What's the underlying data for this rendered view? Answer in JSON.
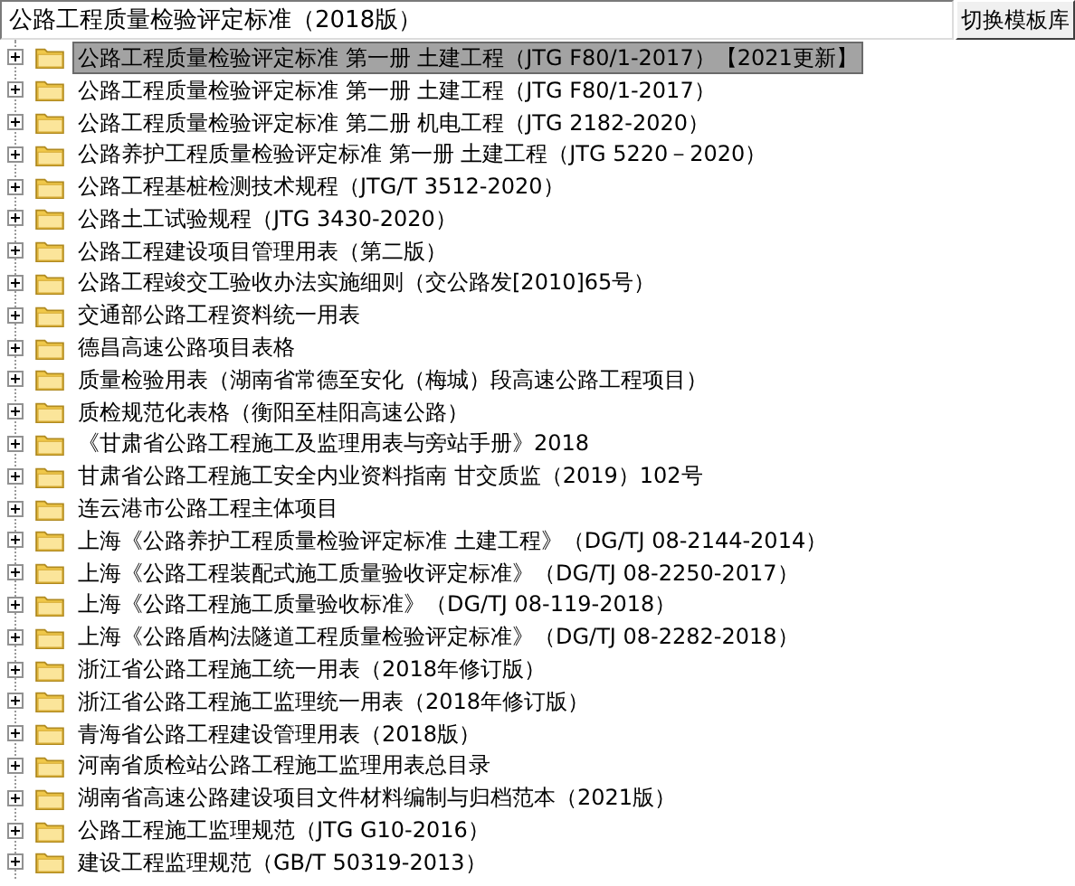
{
  "header": {
    "template_field": {
      "value": "公路工程质量检验评定标准（2018版）"
    },
    "switch_button": {
      "label": "切换模板库"
    }
  },
  "tree": {
    "items": [
      {
        "label": "公路工程质量检验评定标准 第一册 土建工程（JTG F80/1-2017）【2021更新】",
        "selected": true,
        "expanded": false
      },
      {
        "label": "公路工程质量检验评定标准 第一册 土建工程（JTG F80/1-2017）",
        "selected": false,
        "expanded": false
      },
      {
        "label": "公路工程质量检验评定标准 第二册 机电工程（JTG 2182-2020）",
        "selected": false,
        "expanded": false
      },
      {
        "label": "公路养护工程质量检验评定标准 第一册 土建工程（JTG 5220－2020）",
        "selected": false,
        "expanded": false
      },
      {
        "label": "公路工程基桩检测技术规程（JTG/T 3512-2020）",
        "selected": false,
        "expanded": false
      },
      {
        "label": "公路土工试验规程（JTG 3430-2020）",
        "selected": false,
        "expanded": false
      },
      {
        "label": "公路工程建设项目管理用表（第二版）",
        "selected": false,
        "expanded": false
      },
      {
        "label": "公路工程竣交工验收办法实施细则（交公路发[2010]65号）",
        "selected": false,
        "expanded": false
      },
      {
        "label": "交通部公路工程资料统一用表",
        "selected": false,
        "expanded": false
      },
      {
        "label": "德昌高速公路项目表格",
        "selected": false,
        "expanded": false
      },
      {
        "label": "质量检验用表（湖南省常德至安化（梅城）段高速公路工程项目）",
        "selected": false,
        "expanded": false
      },
      {
        "label": "质检规范化表格（衡阳至桂阳高速公路）",
        "selected": false,
        "expanded": false
      },
      {
        "label": "《甘肃省公路工程施工及监理用表与旁站手册》2018",
        "selected": false,
        "expanded": false
      },
      {
        "label": "甘肃省公路工程施工安全内业资料指南 甘交质监（2019）102号",
        "selected": false,
        "expanded": false
      },
      {
        "label": "连云港市公路工程主体项目",
        "selected": false,
        "expanded": false
      },
      {
        "label": "上海《公路养护工程质量检验评定标准 土建工程》（DG/TJ 08-2144-2014）",
        "selected": false,
        "expanded": false
      },
      {
        "label": "上海《公路工程装配式施工质量验收评定标准》（DG/TJ 08-2250-2017）",
        "selected": false,
        "expanded": false
      },
      {
        "label": "上海《公路工程施工质量验收标准》（DG/TJ 08-119-2018）",
        "selected": false,
        "expanded": false
      },
      {
        "label": "上海《公路盾构法隧道工程质量检验评定标准》（DG/TJ 08-2282-2018）",
        "selected": false,
        "expanded": false
      },
      {
        "label": "浙江省公路工程施工统一用表（2018年修订版）",
        "selected": false,
        "expanded": false
      },
      {
        "label": "浙江省公路工程施工监理统一用表（2018年修订版）",
        "selected": false,
        "expanded": false
      },
      {
        "label": "青海省公路工程建设管理用表（2018版）",
        "selected": false,
        "expanded": false
      },
      {
        "label": "河南省质检站公路工程施工监理用表总目录",
        "selected": false,
        "expanded": false
      },
      {
        "label": "湖南省高速公路建设项目文件材料编制与归档范本（2021版）",
        "selected": false,
        "expanded": false
      },
      {
        "label": "公路工程施工监理规范（JTG G10-2016）",
        "selected": false,
        "expanded": false
      },
      {
        "label": "建设工程监理规范（GB/T 50319-2013）",
        "selected": false,
        "expanded": false
      }
    ]
  }
}
